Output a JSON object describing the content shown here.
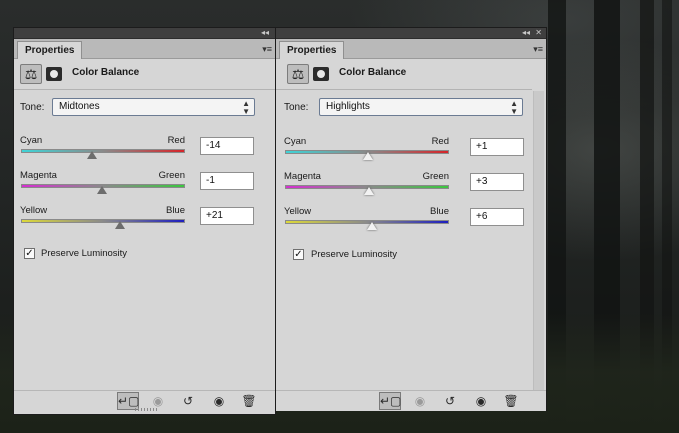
{
  "panels": [
    {
      "tab_label": "Properties",
      "adjustment_title": "Color Balance",
      "tone_label": "Tone:",
      "tone_value": "Midtones",
      "sliders": [
        {
          "left_label": "Cyan",
          "right_label": "Red",
          "value": "-14",
          "position": -14
        },
        {
          "left_label": "Magenta",
          "right_label": "Green",
          "value": "-1",
          "position": -1
        },
        {
          "left_label": "Yellow",
          "right_label": "Blue",
          "value": "+21",
          "position": 21
        }
      ],
      "preserve_luminosity_label": "Preserve Luminosity",
      "preserve_luminosity_checked": true
    },
    {
      "tab_label": "Properties",
      "adjustment_title": "Color Balance",
      "tone_label": "Tone:",
      "tone_value": "Highlights",
      "sliders": [
        {
          "left_label": "Cyan",
          "right_label": "Red",
          "value": "+1",
          "position": 1
        },
        {
          "left_label": "Magenta",
          "right_label": "Green",
          "value": "+3",
          "position": 3
        },
        {
          "left_label": "Yellow",
          "right_label": "Blue",
          "value": "+6",
          "position": 6
        }
      ],
      "preserve_luminosity_label": "Preserve Luminosity",
      "preserve_luminosity_checked": true
    }
  ],
  "slider_range": [
    -100,
    100
  ],
  "icons": {
    "adjustment": "color-balance-scales-icon",
    "mask": "layer-mask-icon",
    "footer": [
      "clip-to-layer-icon",
      "view-previous-state-icon",
      "reset-icon",
      "visibility-eye-icon",
      "delete-trash-icon"
    ]
  },
  "colors": {
    "panel_bg": "#d6d6d6",
    "cyan_red": [
      "#3fd3d6",
      "#8a8a8a",
      "#d6252a"
    ],
    "magenta_green": [
      "#d52fd1",
      "#8a8a8a",
      "#3bc63f"
    ],
    "yellow_blue": [
      "#dcd83a",
      "#8a8a8a",
      "#1e1fbf"
    ]
  }
}
